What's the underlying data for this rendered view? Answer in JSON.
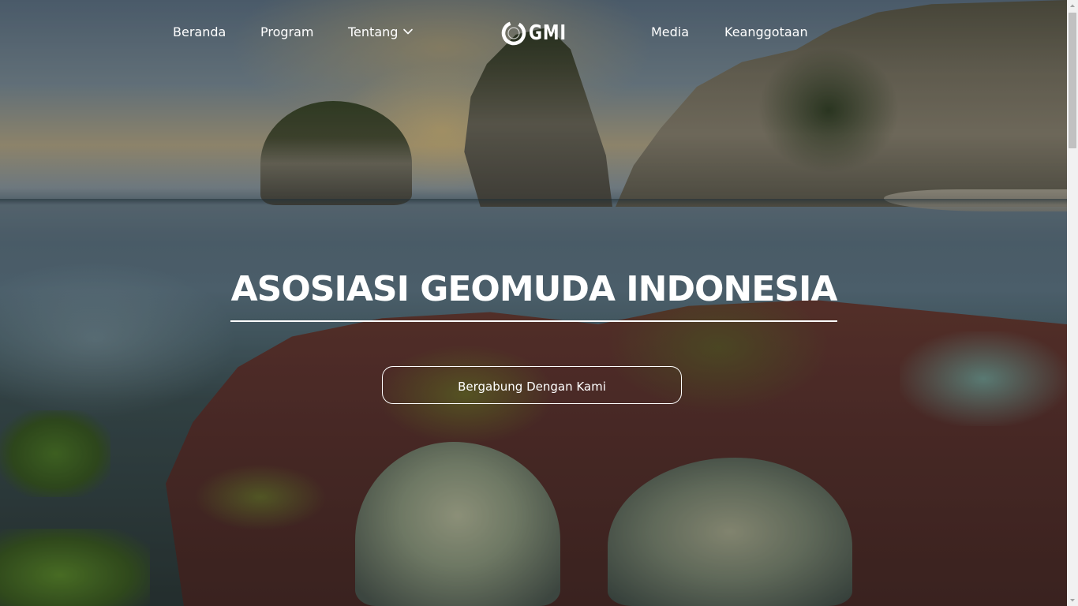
{
  "nav": {
    "items": [
      {
        "label": "Beranda"
      },
      {
        "label": "Program"
      },
      {
        "label": "Tentang",
        "has_dropdown": true
      },
      {
        "label": "Media"
      },
      {
        "label": "Keanggotaan"
      }
    ]
  },
  "logo": {
    "text": "GMI"
  },
  "hero": {
    "title": "ASOSIASI GEOMUDA INDONESIA",
    "cta_label": "Bergabung Dengan Kami"
  },
  "colors": {
    "text": "#ffffff",
    "scrollbar_track": "#f1f1f1",
    "scrollbar_thumb": "#c1c1c1"
  },
  "icons": {
    "dropdown": "chevron-down-icon",
    "logo_mark": "ring-logo-icon"
  }
}
